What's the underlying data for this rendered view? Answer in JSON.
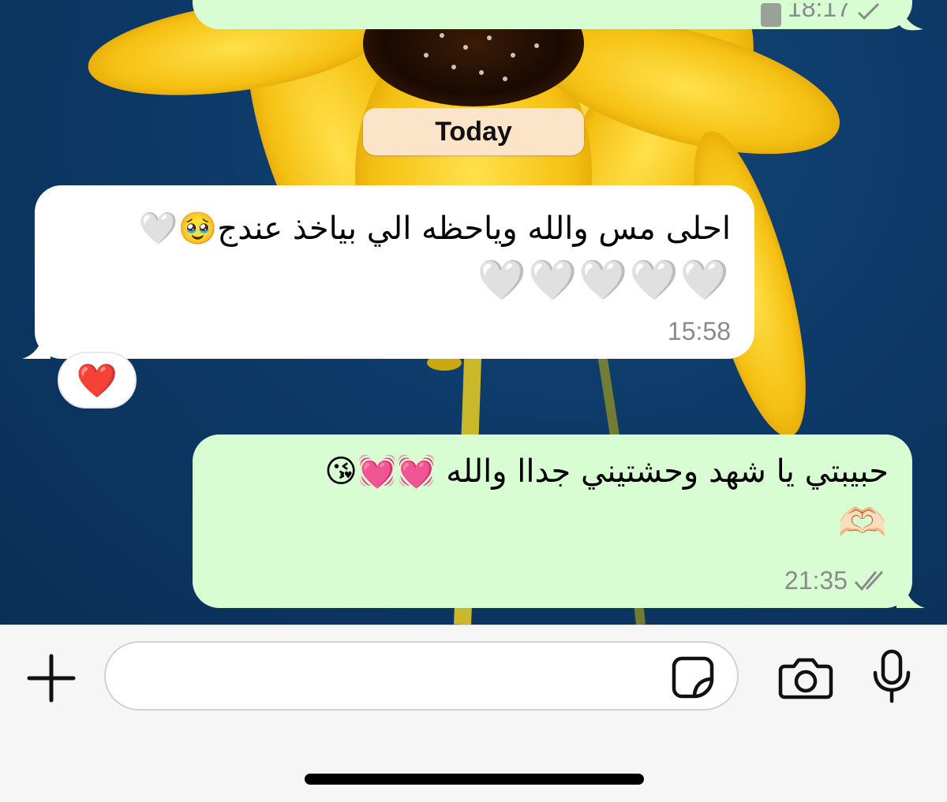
{
  "conversation": {
    "previous_message": {
      "time": "18:17",
      "status_icon": "double-check-icon"
    },
    "date_separator": "Today",
    "incoming_message": {
      "text": "احلى مس والله وياحظه الي بياخذ عندج🥹🤍",
      "emoji_line": "🤍🤍🤍🤍🤍",
      "time": "15:58",
      "reaction": "❤️"
    },
    "outgoing_message": {
      "text": "حبيبتي يا شهد وحشتيني جداا والله 💓💓😘",
      "emoji_line": "🫶🏻",
      "time": "21:35",
      "status_icon": "double-check-icon"
    }
  },
  "composer": {
    "input_value": "",
    "input_placeholder": "",
    "icons": [
      "plus-icon",
      "sticker-icon",
      "camera-icon",
      "microphone-icon"
    ]
  },
  "colors": {
    "incoming_bubble": "#ffffff",
    "outgoing_bubble": "#d9fdd3",
    "date_chip": "#fbe4c8",
    "timestamp": "#8a8a8a",
    "wallpaper_background": "#0e3a66",
    "composer_background": "#f6f6f6"
  }
}
